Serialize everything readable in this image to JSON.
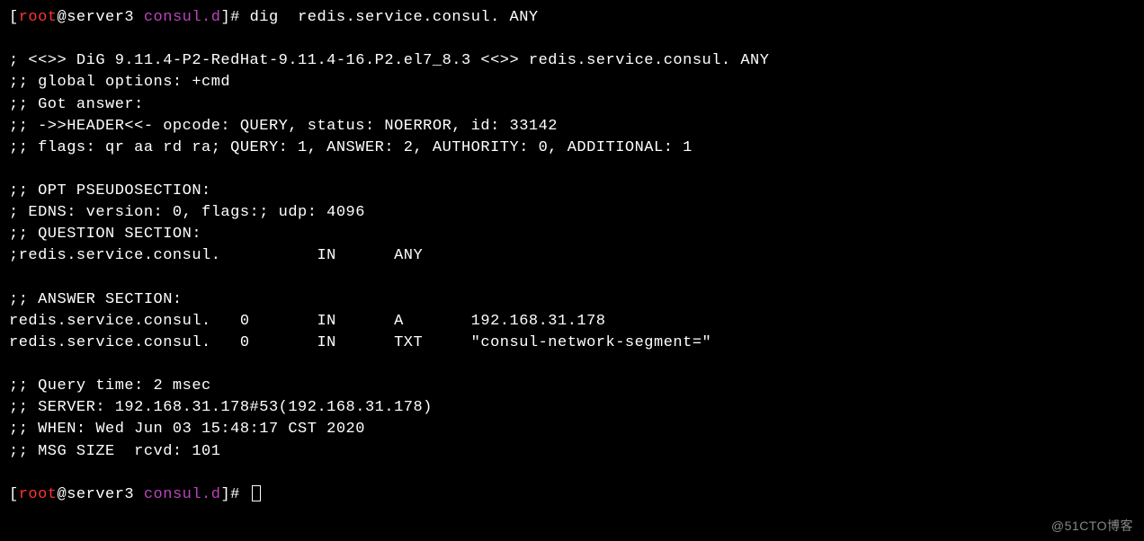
{
  "prompt1": {
    "bracket_open": "[",
    "user": "root",
    "at_host": "@server3 ",
    "dir": "consul.d",
    "bracket_close": "]# ",
    "command": "dig  redis.service.consul. ANY"
  },
  "output": {
    "line1": "; <<>> DiG 9.11.4-P2-RedHat-9.11.4-16.P2.el7_8.3 <<>> redis.service.consul. ANY",
    "line2": ";; global options: +cmd",
    "line3": ";; Got answer:",
    "line4": ";; ->>HEADER<<- opcode: QUERY, status: NOERROR, id: 33142",
    "line5": ";; flags: qr aa rd ra; QUERY: 1, ANSWER: 2, AUTHORITY: 0, ADDITIONAL: 1",
    "line6": ";; OPT PSEUDOSECTION:",
    "line7": "; EDNS: version: 0, flags:; udp: 4096",
    "line8": ";; QUESTION SECTION:",
    "line9": ";redis.service.consul.          IN      ANY",
    "line10": ";; ANSWER SECTION:",
    "line11": "redis.service.consul.   0       IN      A       192.168.31.178",
    "line12": "redis.service.consul.   0       IN      TXT     \"consul-network-segment=\"",
    "line13": ";; Query time: 2 msec",
    "line14": ";; SERVER: 192.168.31.178#53(192.168.31.178)",
    "line15": ";; WHEN: Wed Jun 03 15:48:17 CST 2020",
    "line16": ";; MSG SIZE  rcvd: 101"
  },
  "prompt2": {
    "bracket_open": "[",
    "user": "root",
    "at_host": "@server3 ",
    "dir": "consul.d",
    "bracket_close": "]# "
  },
  "watermark": "@51CTO博客"
}
